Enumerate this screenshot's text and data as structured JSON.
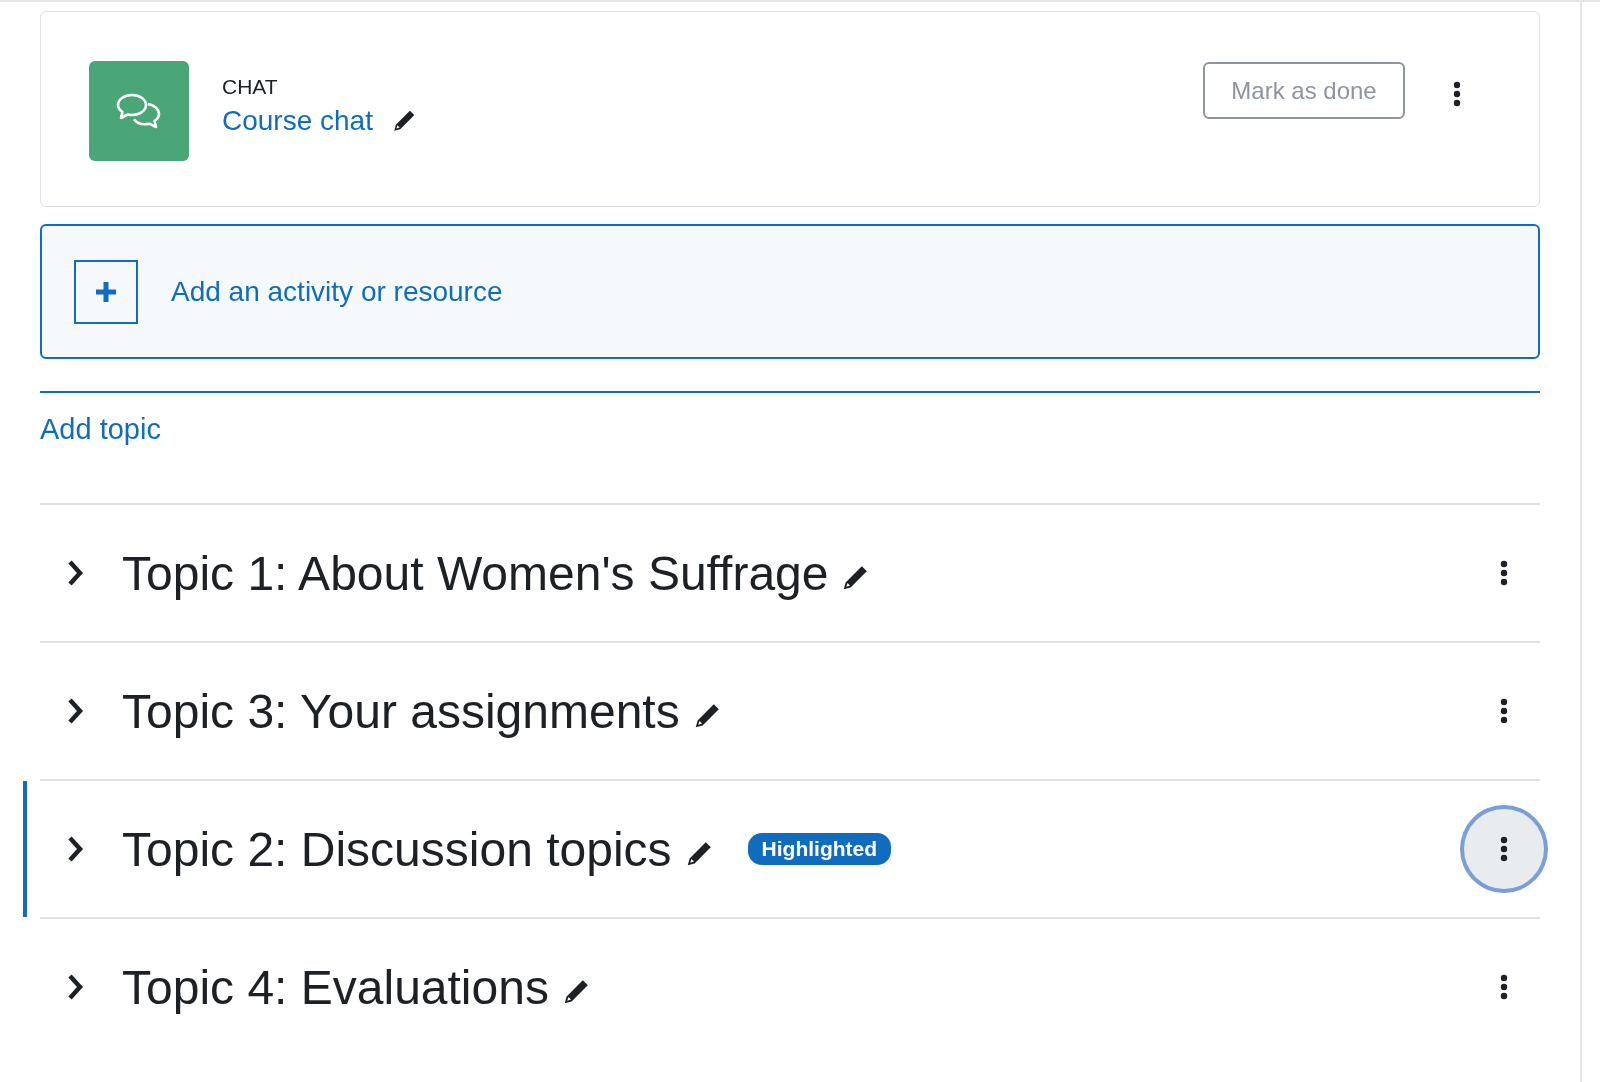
{
  "activity": {
    "type_label": "CHAT",
    "name": "Course chat",
    "completion_button": "Mark as done"
  },
  "add_activity": {
    "label": "Add an activity or resource"
  },
  "add_topic": {
    "label": "Add topic"
  },
  "topics": [
    {
      "title": "Topic 1: About Women's Suffrage",
      "expanded": false,
      "highlighted": false,
      "menu_focused": false
    },
    {
      "title": "Topic 3: Your assignments",
      "expanded": false,
      "highlighted": false,
      "menu_focused": false
    },
    {
      "title": "Topic 2: Discussion topics",
      "expanded": false,
      "highlighted": true,
      "badge": "Highlighted",
      "menu_focused": true
    },
    {
      "title": "Topic 4: Evaluations",
      "expanded": false,
      "highlighted": false,
      "menu_focused": false
    }
  ]
}
